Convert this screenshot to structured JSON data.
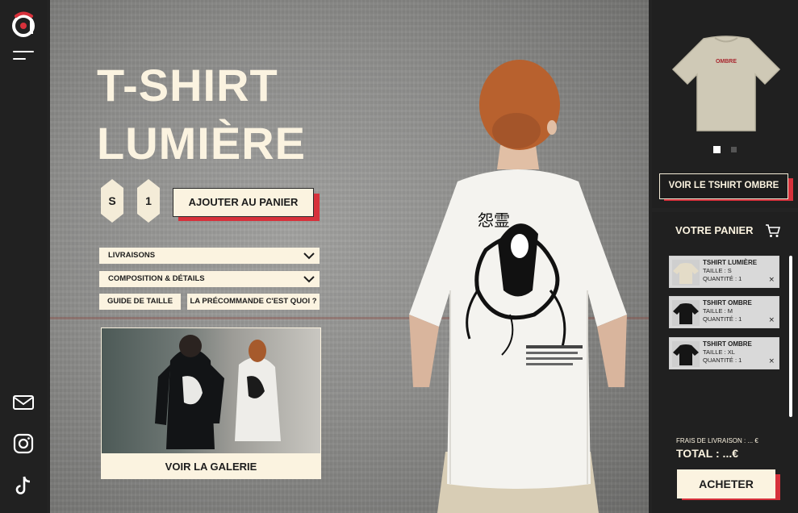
{
  "brand": {
    "logo": "logo-icon",
    "accent": "#d7313b",
    "cream": "#fbf3e0",
    "dark": "#212121"
  },
  "sidebar": {
    "menu_icon": "hamburger-menu-icon",
    "social": [
      "mail-icon",
      "instagram-icon",
      "tiktok-icon"
    ]
  },
  "hero": {
    "title_line1": "T-SHIRT",
    "title_line2": "LUMIÈRE",
    "size_value": "S",
    "quantity_value": "1",
    "add_to_cart_label": "AJOUTER AU PANIER",
    "accordions": [
      {
        "label": "LIVRAISONS"
      },
      {
        "label": "COMPOSITION & DÉTAILS"
      }
    ],
    "size_guide_label": "GUIDE DE TAILLE",
    "preorder_label": "LA PRÉCOMMANDE C'EST QUOI ?",
    "gallery_label": "VOIR LA GALERIE"
  },
  "product_preview": {
    "tshirt_print_text": "OMBRE",
    "see_button_label": "VOIR LE TSHIRT OMBRE",
    "active_slide": 1,
    "slide_count": 2
  },
  "cart": {
    "title": "VOTRE PANIER",
    "items": [
      {
        "name": "TSHIRT LUMIÈRE",
        "size": "TAILLE : S",
        "qty": "QUANTITÉ : 1",
        "color": "cream",
        "remove": "×"
      },
      {
        "name": "TSHIRT OMBRE",
        "size": "TAILLE : M",
        "qty": "QUANTITÉ : 1",
        "color": "black",
        "remove": "×"
      },
      {
        "name": "TSHIRT OMBRE",
        "size": "TAILLE : XL",
        "qty": "QUANTITÉ : 1",
        "color": "black",
        "remove": "×"
      }
    ],
    "shipping": "FRAIS DE LIVRAISON : ... €",
    "total": "TOTAL : ...€",
    "buy_label": "ACHETER"
  }
}
